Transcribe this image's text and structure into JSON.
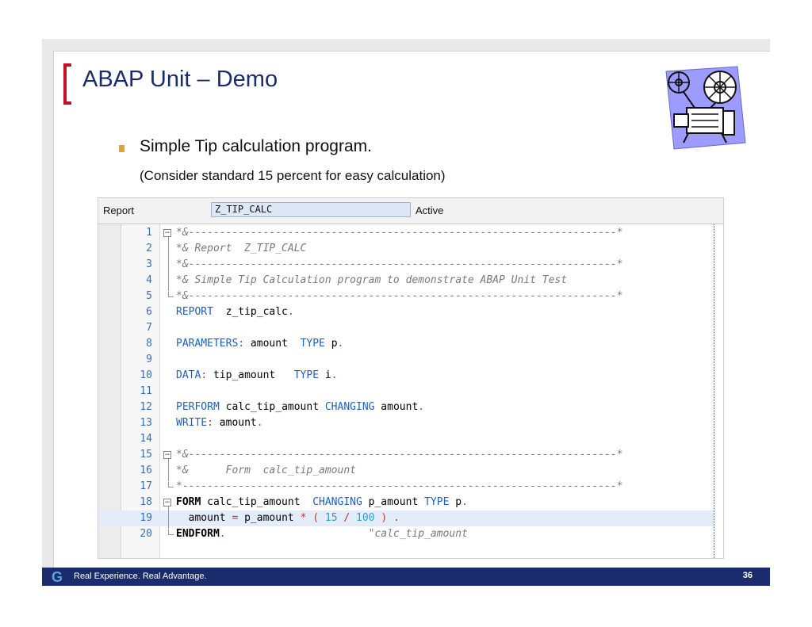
{
  "slide": {
    "title": "ABAP Unit – Demo",
    "bullet": "Simple Tip calculation program.",
    "subtext": "(Consider standard 15 percent for easy calculation)",
    "icon": "film-projector-icon",
    "brand_color": "#1a2c6b",
    "accent_color": "#c8102e"
  },
  "editor": {
    "label": "Report",
    "program_name": "Z_TIP_CALC",
    "status": "Active",
    "lines": [
      {
        "n": "1",
        "tokens": [
          {
            "t": "*&---------------------------------------------------------------------*",
            "c": "cmt"
          }
        ]
      },
      {
        "n": "2",
        "tokens": [
          {
            "t": "*& Report  Z_TIP_CALC",
            "c": "cmt"
          }
        ]
      },
      {
        "n": "3",
        "tokens": [
          {
            "t": "*&---------------------------------------------------------------------*",
            "c": "cmt"
          }
        ]
      },
      {
        "n": "4",
        "tokens": [
          {
            "t": "*& Simple Tip Calculation program to demonstrate ABAP Unit Test",
            "c": "cmt"
          }
        ]
      },
      {
        "n": "5",
        "tokens": [
          {
            "t": "*&---------------------------------------------------------------------*",
            "c": "cmt"
          }
        ]
      },
      {
        "n": "6",
        "tokens": [
          {
            "t": "REPORT",
            "c": "kw"
          },
          {
            "t": "  z_tip_calc",
            "c": "txt"
          },
          {
            "t": ".",
            "c": "op"
          }
        ]
      },
      {
        "n": "7",
        "tokens": []
      },
      {
        "n": "8",
        "tokens": [
          {
            "t": "PARAMETERS",
            "c": "kw"
          },
          {
            "t": ":",
            "c": "op"
          },
          {
            "t": " amount  ",
            "c": "txt"
          },
          {
            "t": "TYPE",
            "c": "kw"
          },
          {
            "t": " p",
            "c": "txt"
          },
          {
            "t": ".",
            "c": "op"
          }
        ]
      },
      {
        "n": "9",
        "tokens": []
      },
      {
        "n": "10",
        "tokens": [
          {
            "t": "DATA",
            "c": "kw"
          },
          {
            "t": ":",
            "c": "op"
          },
          {
            "t": " tip_amount   ",
            "c": "txt"
          },
          {
            "t": "TYPE",
            "c": "kw"
          },
          {
            "t": " i",
            "c": "txt"
          },
          {
            "t": ".",
            "c": "op"
          }
        ]
      },
      {
        "n": "11",
        "tokens": []
      },
      {
        "n": "12",
        "tokens": [
          {
            "t": "PERFORM",
            "c": "kw"
          },
          {
            "t": " calc_tip_amount ",
            "c": "txt"
          },
          {
            "t": "CHANGING",
            "c": "kw"
          },
          {
            "t": " amount",
            "c": "txt"
          },
          {
            "t": ".",
            "c": "op"
          }
        ]
      },
      {
        "n": "13",
        "tokens": [
          {
            "t": "WRITE",
            "c": "kw"
          },
          {
            "t": ":",
            "c": "op"
          },
          {
            "t": " amount",
            "c": "txt"
          },
          {
            "t": ".",
            "c": "op"
          }
        ]
      },
      {
        "n": "14",
        "tokens": []
      },
      {
        "n": "15",
        "tokens": [
          {
            "t": "*&---------------------------------------------------------------------*",
            "c": "cmt"
          }
        ]
      },
      {
        "n": "16",
        "tokens": [
          {
            "t": "*&      Form  calc_tip_amount",
            "c": "cmt"
          }
        ]
      },
      {
        "n": "17",
        "tokens": [
          {
            "t": "*----------------------------------------------------------------------*",
            "c": "cmt"
          }
        ]
      },
      {
        "n": "18",
        "tokens": [
          {
            "t": "FORM",
            "c": "bold"
          },
          {
            "t": " calc_tip_amount  ",
            "c": "txt"
          },
          {
            "t": "CHANGING",
            "c": "kw"
          },
          {
            "t": " p_amount ",
            "c": "txt"
          },
          {
            "t": "TYPE",
            "c": "kw"
          },
          {
            "t": " p",
            "c": "txt"
          },
          {
            "t": ".",
            "c": "op"
          }
        ]
      },
      {
        "n": "19",
        "tokens": [
          {
            "t": "  amount ",
            "c": "txt"
          },
          {
            "t": "=",
            "c": "op"
          },
          {
            "t": " p_amount ",
            "c": "txt"
          },
          {
            "t": "*",
            "c": "op"
          },
          {
            "t": " ",
            "c": "txt"
          },
          {
            "t": "(",
            "c": "op"
          },
          {
            "t": " ",
            "c": "txt"
          },
          {
            "t": "15",
            "c": "num"
          },
          {
            "t": " ",
            "c": "txt"
          },
          {
            "t": "/",
            "c": "op"
          },
          {
            "t": " ",
            "c": "txt"
          },
          {
            "t": "100",
            "c": "num"
          },
          {
            "t": " ",
            "c": "txt"
          },
          {
            "t": ")",
            "c": "op"
          },
          {
            "t": " ",
            "c": "txt"
          },
          {
            "t": ".",
            "c": "op"
          }
        ]
      },
      {
        "n": "20",
        "tokens": [
          {
            "t": "ENDFORM",
            "c": "bold"
          },
          {
            "t": ".",
            "c": "op"
          },
          {
            "t": "                       ",
            "c": "txt"
          },
          {
            "t": "\"calc_tip_amount",
            "c": "cmt"
          }
        ]
      }
    ]
  },
  "footer": {
    "logo": "G",
    "tagline": "Real Experience. Real Advantage.",
    "page_number": "36"
  }
}
